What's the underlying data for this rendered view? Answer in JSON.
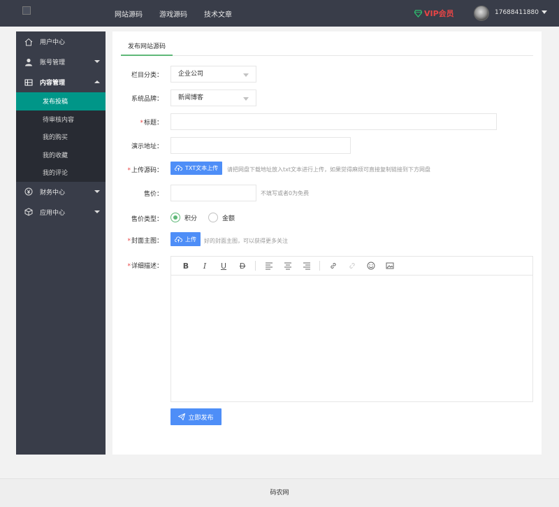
{
  "header": {
    "nav": [
      "网站源码",
      "游戏源码",
      "技术文章"
    ],
    "vip_label": "VIP会员",
    "username": "17688411880",
    "vip_color": "#e84545"
  },
  "sidebar": {
    "items": [
      {
        "label": "用户中心",
        "icon": "home-icon"
      },
      {
        "label": "账号管理",
        "icon": "user-icon"
      },
      {
        "label": "内容管理",
        "icon": "grid-icon"
      },
      {
        "label": "财务中心",
        "icon": "yen-icon"
      },
      {
        "label": "应用中心",
        "icon": "box-icon"
      }
    ],
    "sub_items": [
      "发布投稿",
      "待审核内容",
      "我的购买",
      "我的收藏",
      "我的评论"
    ],
    "active_color": "#009688"
  },
  "main": {
    "tab": "发布网站源码",
    "form": {
      "category_label": "栏目分类：",
      "category_value": "企业公司",
      "brand_label": "系统品牌：",
      "brand_value": "新闻博客",
      "title_label": "标题：",
      "demo_label": "演示地址：",
      "source_label": "上传源码：",
      "source_button": "TXT文本上传",
      "source_hint": "请把网盘下载地址放入txt文本进行上传，如果觉得麻烦可直接复制链接到下方网盘",
      "price_label": "售价：",
      "price_hint": "不填写或者0为免费",
      "price_type_label": "售价类型：",
      "price_type_options": [
        "积分",
        "金额"
      ],
      "price_type_selected": "积分",
      "cover_label": "封面主图：",
      "cover_button": "上传",
      "cover_hint": "好的封面主图，可以获得更多关注",
      "desc_label": "详细描述：",
      "submit_label": "立即发布"
    }
  },
  "footer": {
    "text": "码农网"
  }
}
